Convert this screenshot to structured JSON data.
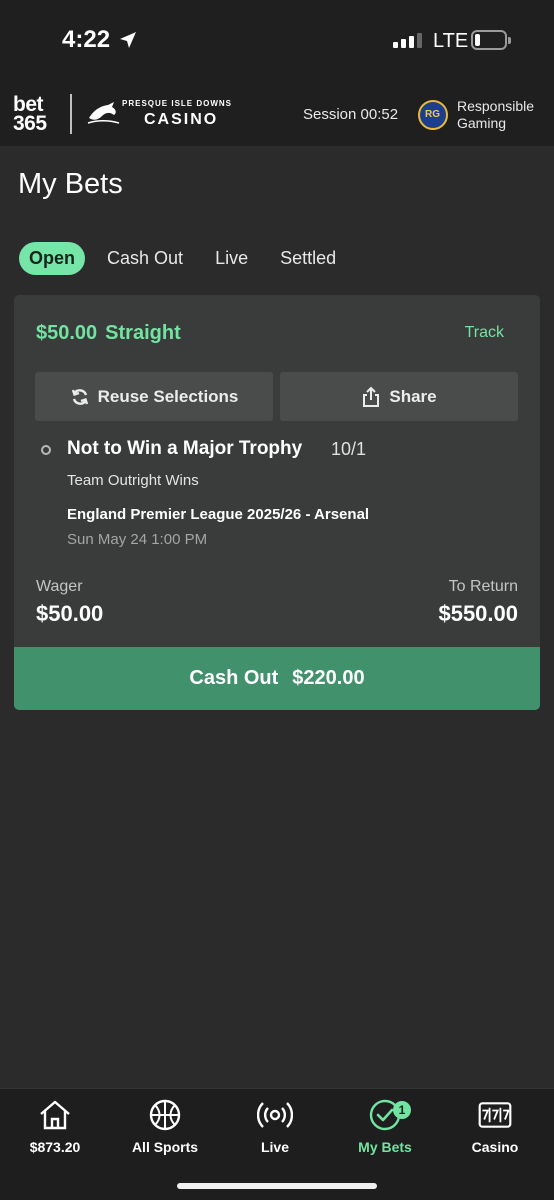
{
  "status_bar": {
    "time": "4:22",
    "network": "LTE"
  },
  "header": {
    "bet365_line1": "bet",
    "bet365_line2": "365",
    "casino_top": "PRESQUE ISLE DOWNS",
    "casino_main": "CASINO",
    "session_label": "Session 00:52",
    "responsible_line1": "Responsible",
    "responsible_line2": "Gaming"
  },
  "page": {
    "title": "My Bets"
  },
  "tabs": [
    {
      "label": "Open",
      "active": true
    },
    {
      "label": "Cash Out",
      "active": false
    },
    {
      "label": "Live",
      "active": false
    },
    {
      "label": "Settled",
      "active": false
    }
  ],
  "bet": {
    "stake": "$50.00",
    "type": "Straight",
    "track_label": "Track",
    "reuse_label": "Reuse Selections",
    "share_label": "Share",
    "selection": "Not to Win a Major Trophy",
    "odds": "10/1",
    "market": "Team Outright Wins",
    "event": "England Premier League 2025/26 - Arsenal",
    "date": "Sun May 24 1:00 PM",
    "wager_label": "Wager",
    "wager_value": "$50.00",
    "return_label": "To Return",
    "return_value": "$550.00",
    "cashout_label": "Cash Out",
    "cashout_value": "$220.00"
  },
  "nav": {
    "items": [
      {
        "label": "$873.20",
        "icon": "home-icon"
      },
      {
        "label": "All Sports",
        "icon": "basketball-icon"
      },
      {
        "label": "Live",
        "icon": "broadcast-icon"
      },
      {
        "label": "My Bets",
        "icon": "check-circle-icon",
        "badge": "1"
      },
      {
        "label": "Casino",
        "icon": "slot-machine-icon"
      }
    ]
  },
  "colors": {
    "accent_green": "#73e3a1",
    "cashout_green": "#41916c",
    "background": "#2b2b2b",
    "card": "#3a3c3b"
  }
}
